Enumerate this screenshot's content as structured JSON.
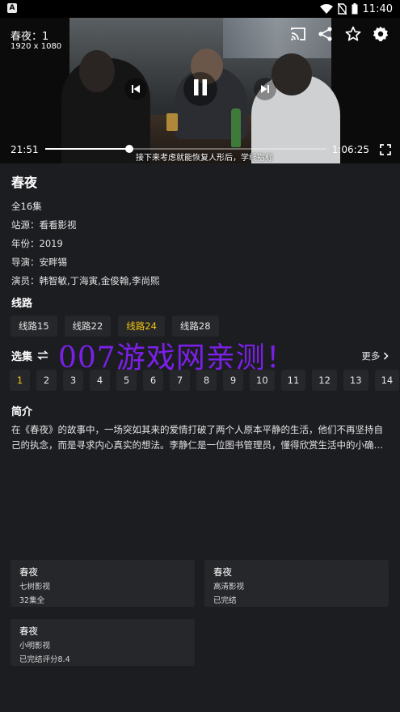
{
  "status_bar": {
    "app_badge": "A",
    "time": "11:40"
  },
  "player": {
    "title": "春夜：1",
    "resolution": "1920 x 1080",
    "current_time": "21:51",
    "total_time": "1:06:25",
    "progress": 0.3,
    "subtitle": "接下来考虑就能恢复人形后，学线指标"
  },
  "info": {
    "title": "春夜",
    "lines": [
      "全16集",
      "站源：看看影视",
      "年份：2019",
      "导演：安畔锡",
      "演员：韩智敏,丁海寅,金俊翰,李尚熙"
    ]
  },
  "routes": {
    "title": "线路",
    "items": [
      "线路15",
      "线路22",
      "线路24",
      "线路28"
    ],
    "active_index": 2
  },
  "episodes": {
    "title": "选集",
    "more": "更多",
    "items": [
      "1",
      "2",
      "3",
      "4",
      "5",
      "6",
      "7",
      "8",
      "9",
      "10",
      "11",
      "12",
      "13",
      "14"
    ],
    "active_index": 0
  },
  "synopsis": {
    "title": "简介",
    "text": "在《春夜》的故事中，一场突如其来的爱情打破了两个人原本平静的生活，他们不再坚持自己的执念，而是寻求内心真实的想法。李静仁是一位图书管理员，懂得欣赏生活中的小确…"
  },
  "watermark": "007游戏网亲测！",
  "related": [
    {
      "title": "春夜",
      "source": "七树影视",
      "status": "32集全"
    },
    {
      "title": "春夜",
      "source": "高清影视",
      "status": "已完结"
    },
    {
      "title": "春夜",
      "source": "小明影视",
      "status": "已完结评分8.4"
    }
  ],
  "colors": {
    "background": "#1c1d21",
    "chip": "#26272b",
    "accent": "#f1c40f",
    "watermark": "#7b20e8"
  }
}
